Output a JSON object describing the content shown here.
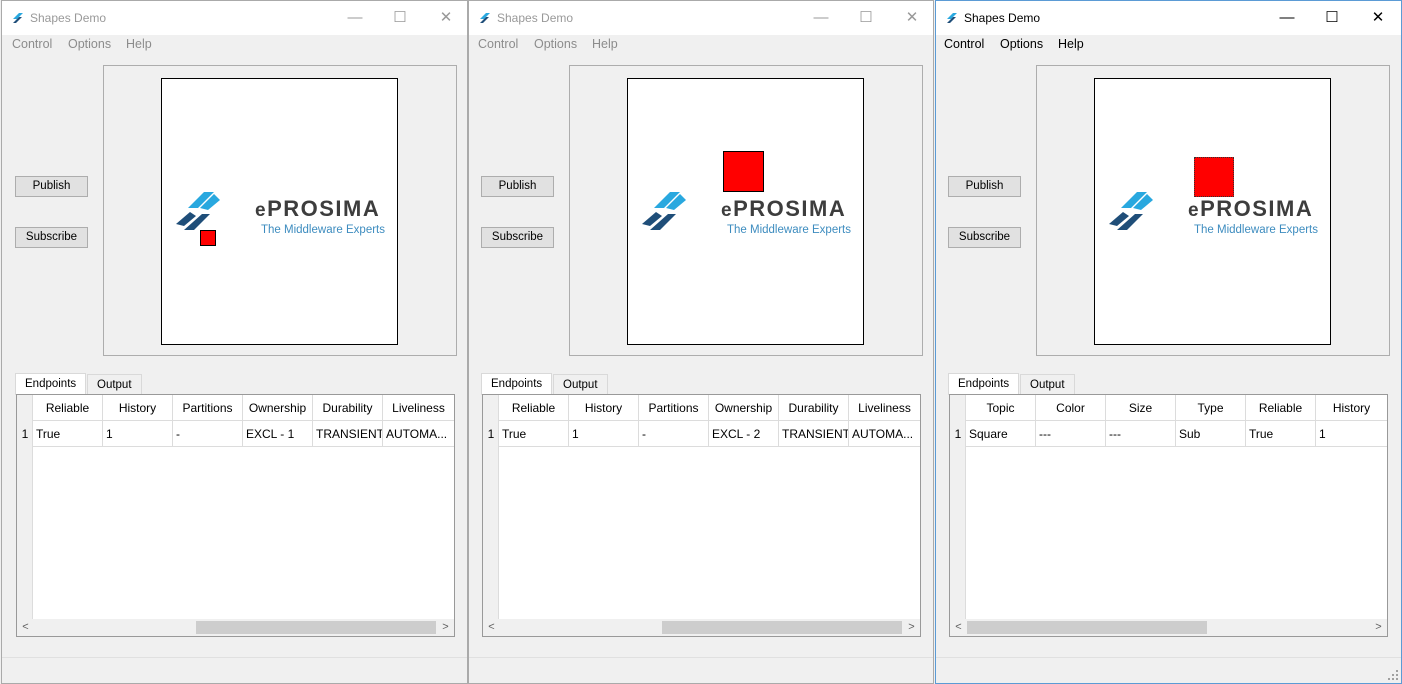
{
  "colors": {
    "shape_red": "#ff0000",
    "logo_blue": "#3d8cbf",
    "logo_dark": "#1f4e79",
    "logo_light": "#29a8df"
  },
  "logo": {
    "title_e": "e",
    "title_rest": "PROSIMA",
    "subtitle": "The Middleware Experts"
  },
  "windows": [
    {
      "title": "Shapes Demo",
      "controls": {
        "minimize": "—",
        "maximize": "☐",
        "close": "✕"
      },
      "menu": [
        "Control",
        "Options",
        "Help"
      ],
      "buttons": {
        "publish": "Publish",
        "subscribe": "Subscribe"
      },
      "tabs": [
        "Endpoints",
        "Output"
      ],
      "table": {
        "columns": [
          "Reliable",
          "History",
          "Partitions",
          "Ownership",
          "Durability",
          "Liveliness"
        ],
        "row_number": "1",
        "row": [
          "True",
          "1",
          "-",
          "EXCL - 1",
          "TRANSIENT",
          "AUTOMA..."
        ]
      }
    },
    {
      "title": "Shapes Demo",
      "controls": {
        "minimize": "—",
        "maximize": "☐",
        "close": "✕"
      },
      "menu": [
        "Control",
        "Options",
        "Help"
      ],
      "buttons": {
        "publish": "Publish",
        "subscribe": "Subscribe"
      },
      "tabs": [
        "Endpoints",
        "Output"
      ],
      "table": {
        "columns": [
          "Reliable",
          "History",
          "Partitions",
          "Ownership",
          "Durability",
          "Liveliness"
        ],
        "row_number": "1",
        "row": [
          "True",
          "1",
          "-",
          "EXCL - 2",
          "TRANSIENT",
          "AUTOMA..."
        ]
      }
    },
    {
      "title": "Shapes Demo",
      "controls": {
        "minimize": "—",
        "maximize": "☐",
        "close": "✕"
      },
      "menu": [
        "Control",
        "Options",
        "Help"
      ],
      "buttons": {
        "publish": "Publish",
        "subscribe": "Subscribe"
      },
      "tabs": [
        "Endpoints",
        "Output"
      ],
      "table": {
        "columns": [
          "Topic",
          "Color",
          "Size",
          "Type",
          "Reliable",
          "History"
        ],
        "row_number": "1",
        "row": [
          "Square",
          "---",
          "---",
          "Sub",
          "True",
          "1"
        ]
      }
    }
  ],
  "scroll": {
    "left_arrow": "<",
    "right_arrow": ">"
  }
}
